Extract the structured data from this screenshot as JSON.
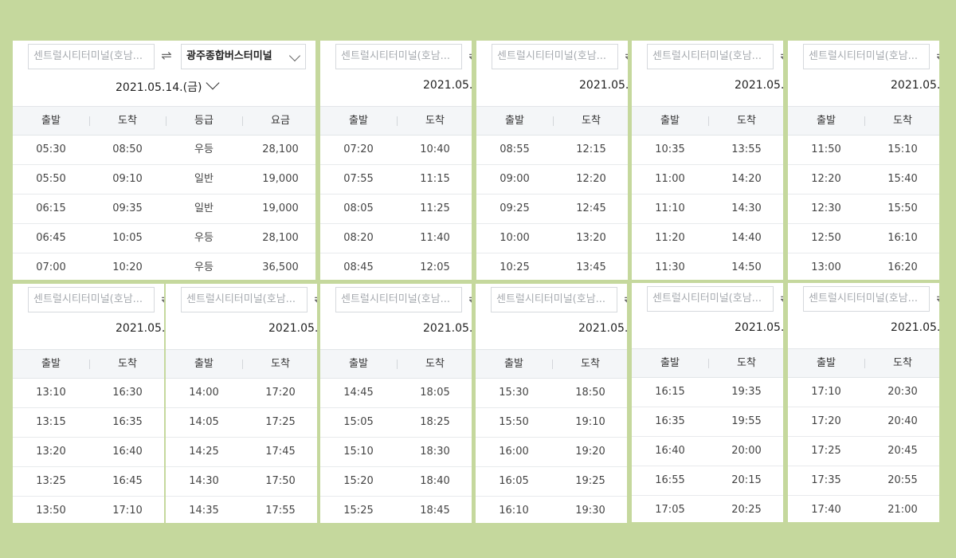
{
  "search": {
    "origin_placeholder": "센트럴시티터미널(호남...",
    "destination_value": "광주종합버스터미널",
    "swap_symbol": "⇌"
  },
  "date_label": "2021.05.14.(금)",
  "date_label_truncated": "2021.05.",
  "columns": {
    "depart": "출발",
    "arrive": "도착",
    "grade": "등급",
    "fare": "요금"
  },
  "panels": [
    {
      "rows": [
        {
          "depart": "05:30",
          "arrive": "08:50",
          "grade": "우등",
          "fare": "28,100"
        },
        {
          "depart": "05:50",
          "arrive": "09:10",
          "grade": "일반",
          "fare": "19,000"
        },
        {
          "depart": "06:15",
          "arrive": "09:35",
          "grade": "일반",
          "fare": "19,000"
        },
        {
          "depart": "06:45",
          "arrive": "10:05",
          "grade": "우등",
          "fare": "28,100"
        },
        {
          "depart": "07:00",
          "arrive": "10:20",
          "grade": "우등",
          "fare": "36,500"
        }
      ]
    },
    {
      "rows": [
        {
          "depart": "07:20",
          "arrive": "10:40"
        },
        {
          "depart": "07:55",
          "arrive": "11:15"
        },
        {
          "depart": "08:05",
          "arrive": "11:25"
        },
        {
          "depart": "08:20",
          "arrive": "11:40"
        },
        {
          "depart": "08:45",
          "arrive": "12:05"
        }
      ]
    },
    {
      "rows": [
        {
          "depart": "08:55",
          "arrive": "12:15"
        },
        {
          "depart": "09:00",
          "arrive": "12:20"
        },
        {
          "depart": "09:25",
          "arrive": "12:45"
        },
        {
          "depart": "10:00",
          "arrive": "13:20"
        },
        {
          "depart": "10:25",
          "arrive": "13:45"
        }
      ]
    },
    {
      "rows": [
        {
          "depart": "10:35",
          "arrive": "13:55"
        },
        {
          "depart": "11:00",
          "arrive": "14:20"
        },
        {
          "depart": "11:10",
          "arrive": "14:30"
        },
        {
          "depart": "11:20",
          "arrive": "14:40"
        },
        {
          "depart": "11:30",
          "arrive": "14:50"
        }
      ]
    },
    {
      "rows": [
        {
          "depart": "11:50",
          "arrive": "15:10"
        },
        {
          "depart": "12:20",
          "arrive": "15:40"
        },
        {
          "depart": "12:30",
          "arrive": "15:50"
        },
        {
          "depart": "12:50",
          "arrive": "16:10"
        },
        {
          "depart": "13:00",
          "arrive": "16:20"
        }
      ]
    },
    {
      "rows": [
        {
          "depart": "13:10",
          "arrive": "16:30"
        },
        {
          "depart": "13:15",
          "arrive": "16:35"
        },
        {
          "depart": "13:20",
          "arrive": "16:40"
        },
        {
          "depart": "13:25",
          "arrive": "16:45"
        },
        {
          "depart": "13:50",
          "arrive": "17:10"
        }
      ]
    },
    {
      "rows": [
        {
          "depart": "14:00",
          "arrive": "17:20"
        },
        {
          "depart": "14:05",
          "arrive": "17:25"
        },
        {
          "depart": "14:25",
          "arrive": "17:45"
        },
        {
          "depart": "14:30",
          "arrive": "17:50"
        },
        {
          "depart": "14:35",
          "arrive": "17:55"
        }
      ]
    },
    {
      "rows": [
        {
          "depart": "14:45",
          "arrive": "18:05"
        },
        {
          "depart": "15:05",
          "arrive": "18:25"
        },
        {
          "depart": "15:10",
          "arrive": "18:30"
        },
        {
          "depart": "15:20",
          "arrive": "18:40"
        },
        {
          "depart": "15:25",
          "arrive": "18:45"
        }
      ]
    },
    {
      "rows": [
        {
          "depart": "15:30",
          "arrive": "18:50"
        },
        {
          "depart": "15:50",
          "arrive": "19:10"
        },
        {
          "depart": "16:00",
          "arrive": "19:20"
        },
        {
          "depart": "16:05",
          "arrive": "19:25"
        },
        {
          "depart": "16:10",
          "arrive": "19:30"
        }
      ]
    },
    {
      "rows": [
        {
          "depart": "16:15",
          "arrive": "19:35"
        },
        {
          "depart": "16:35",
          "arrive": "19:55"
        },
        {
          "depart": "16:40",
          "arrive": "20:00"
        },
        {
          "depart": "16:55",
          "arrive": "20:15"
        },
        {
          "depart": "17:05",
          "arrive": "20:25"
        }
      ]
    },
    {
      "rows": [
        {
          "depart": "17:10",
          "arrive": "20:30"
        },
        {
          "depart": "17:20",
          "arrive": "20:40"
        },
        {
          "depart": "17:25",
          "arrive": "20:45"
        },
        {
          "depart": "17:35",
          "arrive": "20:55"
        },
        {
          "depart": "17:40",
          "arrive": "21:00"
        }
      ]
    }
  ]
}
